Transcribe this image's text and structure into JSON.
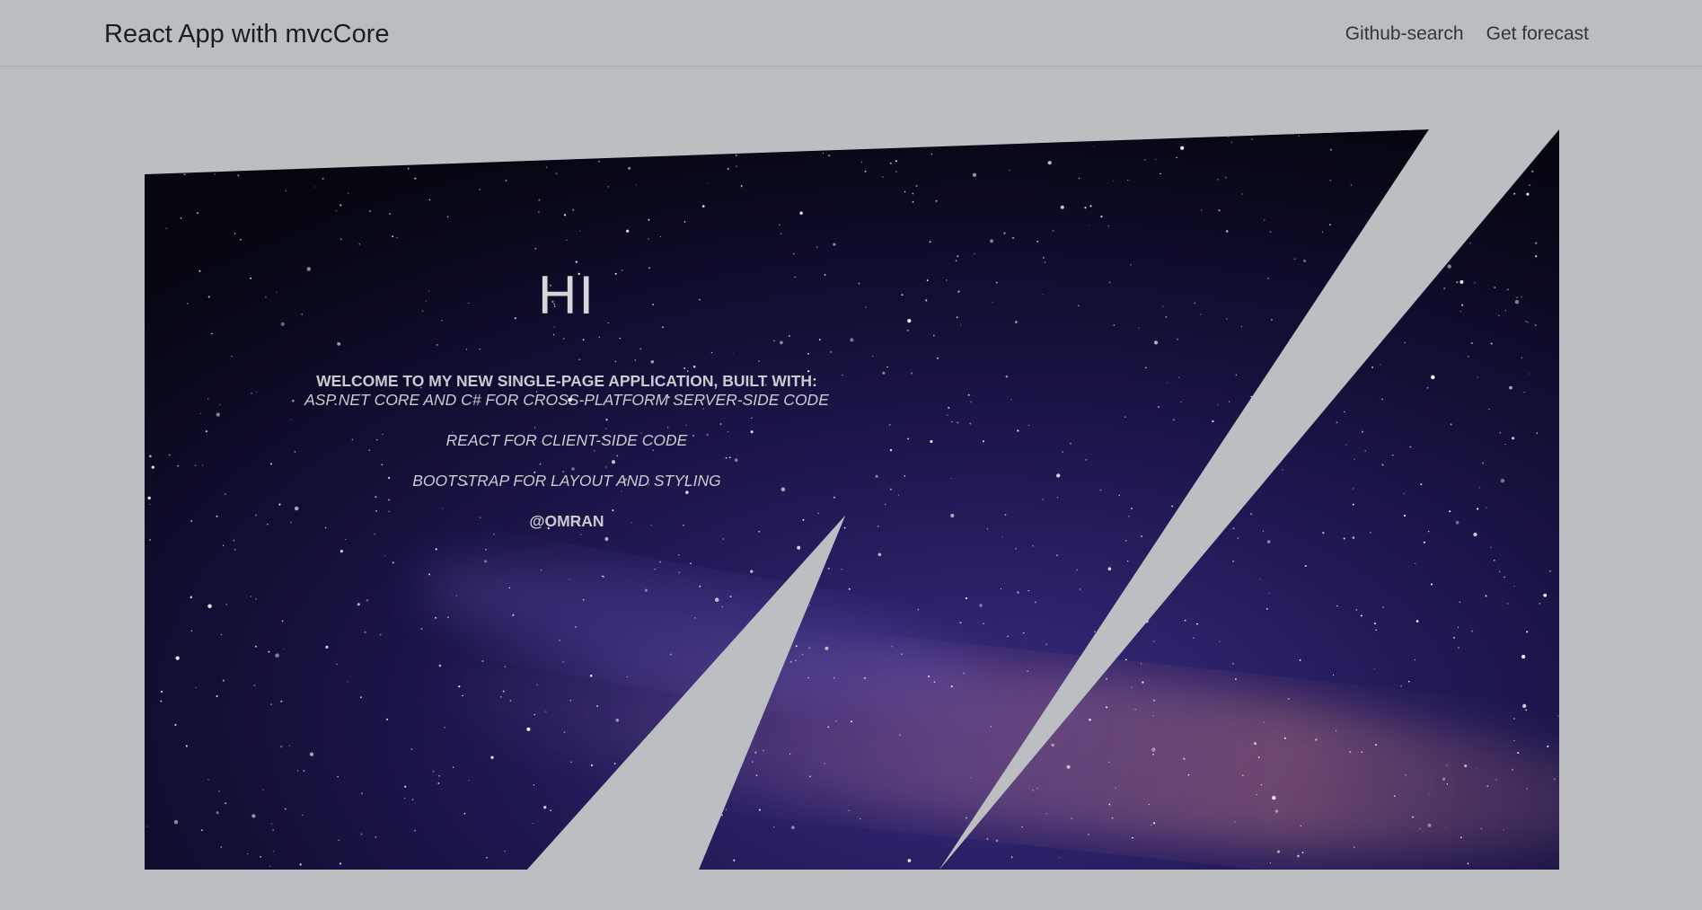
{
  "navbar": {
    "brand": "React App with mvcCore",
    "links": [
      {
        "label": "Github-search"
      },
      {
        "label": "Get forecast"
      }
    ]
  },
  "hero": {
    "heading": "HI",
    "welcome": "WELCOME TO MY NEW SINGLE-PAGE APPLICATION, BUILT WITH:",
    "items": [
      "ASP.NET CORE AND C# FOR CROSS-PLATFORM SERVER-SIDE CODE",
      "REACT FOR CLIENT-SIDE CODE",
      "BOOTSTRAP FOR LAYOUT AND STYLING"
    ],
    "author": "@OMRAN",
    "image": "night-sky-milky-way-image"
  },
  "colors": {
    "page_background": "#bbbfc2",
    "navbar_background": "#babec1",
    "brand_text": "#1c1e20",
    "hero_text": "#c9cbd0",
    "sky_dark": "#05060f",
    "sky_purple": "#2a1f5e"
  }
}
